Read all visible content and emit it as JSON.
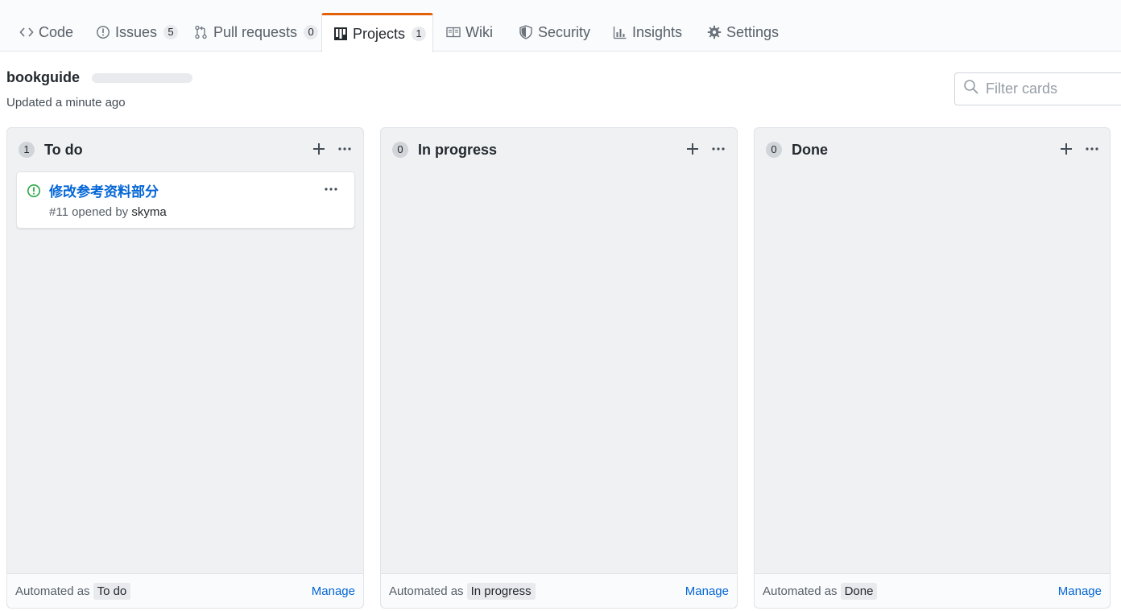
{
  "tabs": [
    {
      "label": "Code",
      "icon": "code-icon"
    },
    {
      "label": "Issues",
      "icon": "issue-opened-icon",
      "count": "5"
    },
    {
      "label": "Pull requests",
      "icon": "git-pull-request-icon",
      "count": "0"
    },
    {
      "label": "Projects",
      "icon": "project-icon",
      "count": "1",
      "selected": true
    },
    {
      "label": "Wiki",
      "icon": "book-icon"
    },
    {
      "label": "Security",
      "icon": "shield-icon"
    },
    {
      "label": "Insights",
      "icon": "graph-icon"
    },
    {
      "label": "Settings",
      "icon": "gear-icon"
    }
  ],
  "project": {
    "title": "bookguide",
    "updated": "Updated a minute ago"
  },
  "filter": {
    "placeholder": "Filter cards",
    "value": ""
  },
  "columns": [
    {
      "count": "1",
      "name": "To do",
      "automated_label": "Automated as",
      "automated_value": "To do",
      "manage_label": "Manage",
      "cards": [
        {
          "title": "修改参考资料部分",
          "number": "#11",
          "opened_by_text": "opened by",
          "author": "skyma",
          "state_color": "#28a745"
        }
      ]
    },
    {
      "count": "0",
      "name": "In progress",
      "automated_label": "Automated as",
      "automated_value": "In progress",
      "manage_label": "Manage",
      "cards": []
    },
    {
      "count": "0",
      "name": "Done",
      "automated_label": "Automated as",
      "automated_value": "Done",
      "manage_label": "Manage",
      "cards": []
    }
  ],
  "colors": {
    "accent_tab": "#e36209",
    "link": "#0366d6",
    "issue_open": "#28a745"
  }
}
